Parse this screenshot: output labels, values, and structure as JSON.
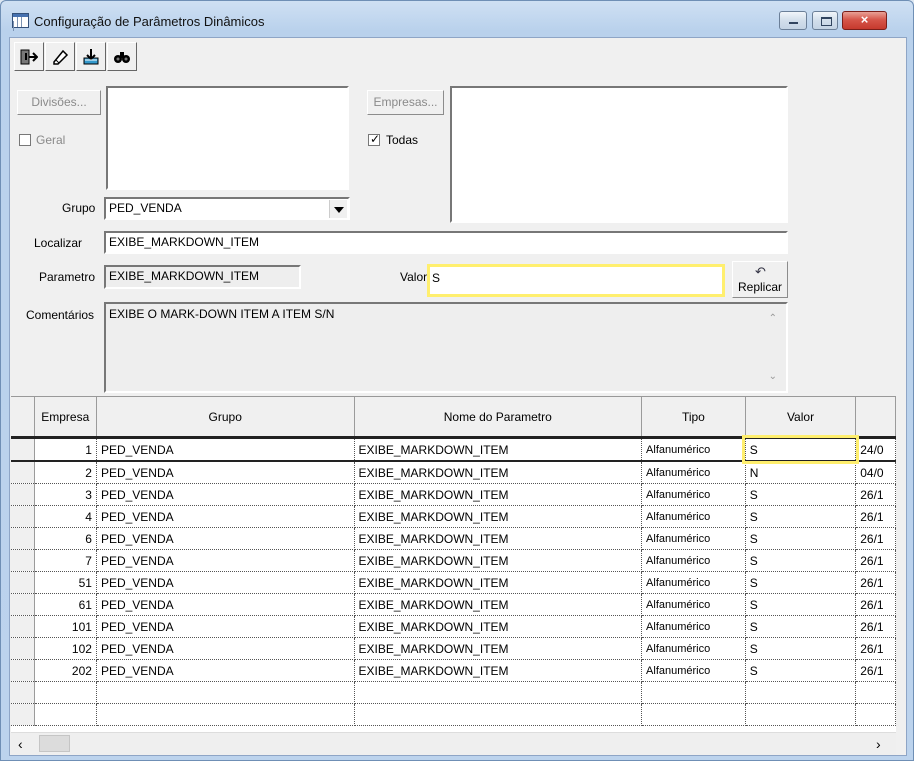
{
  "window": {
    "title": "Configuração de Parâmetros Dinâmicos",
    "close": "×"
  },
  "toolbar": {
    "icons": [
      "exit-icon",
      "clear-icon",
      "save-icon",
      "find-icon"
    ]
  },
  "filters": {
    "divisoes_label": "Divisões...",
    "geral_label": "Geral",
    "empresas_label": "Empresas...",
    "todas_label": "Todas",
    "todas_checked": true,
    "grupo_label": "Grupo",
    "grupo_value": "PED_VENDA",
    "localizar_label": "Localizar",
    "localizar_value": "EXIBE_MARKDOWN_ITEM",
    "parametro_label": "Parametro",
    "parametro_value": "EXIBE_MARKDOWN_ITEM",
    "valor_label": "Valor",
    "valor_value": "S",
    "replicar_label": "Replicar",
    "comentarios_label": "Comentários",
    "comentarios_value": "EXIBE O MARK-DOWN ITEM A ITEM S/N"
  },
  "grid": {
    "headers": [
      "Empresa",
      "Grupo",
      "Nome do Parametro",
      "Tipo",
      "Valor",
      ""
    ],
    "rows": [
      {
        "empresa": "1",
        "grupo": "PED_VENDA",
        "parametro": "EXIBE_MARKDOWN_ITEM",
        "tipo": "Alfanumérico",
        "valor": "S",
        "extra": "24/0"
      },
      {
        "empresa": "2",
        "grupo": "PED_VENDA",
        "parametro": "EXIBE_MARKDOWN_ITEM",
        "tipo": "Alfanumérico",
        "valor": "N",
        "extra": "04/0"
      },
      {
        "empresa": "3",
        "grupo": "PED_VENDA",
        "parametro": "EXIBE_MARKDOWN_ITEM",
        "tipo": "Alfanumérico",
        "valor": "S",
        "extra": "26/1"
      },
      {
        "empresa": "4",
        "grupo": "PED_VENDA",
        "parametro": "EXIBE_MARKDOWN_ITEM",
        "tipo": "Alfanumérico",
        "valor": "S",
        "extra": "26/1"
      },
      {
        "empresa": "6",
        "grupo": "PED_VENDA",
        "parametro": "EXIBE_MARKDOWN_ITEM",
        "tipo": "Alfanumérico",
        "valor": "S",
        "extra": "26/1"
      },
      {
        "empresa": "7",
        "grupo": "PED_VENDA",
        "parametro": "EXIBE_MARKDOWN_ITEM",
        "tipo": "Alfanumérico",
        "valor": "S",
        "extra": "26/1"
      },
      {
        "empresa": "51",
        "grupo": "PED_VENDA",
        "parametro": "EXIBE_MARKDOWN_ITEM",
        "tipo": "Alfanumérico",
        "valor": "S",
        "extra": "26/1"
      },
      {
        "empresa": "61",
        "grupo": "PED_VENDA",
        "parametro": "EXIBE_MARKDOWN_ITEM",
        "tipo": "Alfanumérico",
        "valor": "S",
        "extra": "26/1"
      },
      {
        "empresa": "101",
        "grupo": "PED_VENDA",
        "parametro": "EXIBE_MARKDOWN_ITEM",
        "tipo": "Alfanumérico",
        "valor": "S",
        "extra": "26/1"
      },
      {
        "empresa": "102",
        "grupo": "PED_VENDA",
        "parametro": "EXIBE_MARKDOWN_ITEM",
        "tipo": "Alfanumérico",
        "valor": "S",
        "extra": "26/1"
      },
      {
        "empresa": "202",
        "grupo": "PED_VENDA",
        "parametro": "EXIBE_MARKDOWN_ITEM",
        "tipo": "Alfanumérico",
        "valor": "S",
        "extra": "26/1"
      }
    ]
  },
  "scroll": {
    "left": "‹",
    "right": "›"
  },
  "highlight_color": "#ffef6e"
}
